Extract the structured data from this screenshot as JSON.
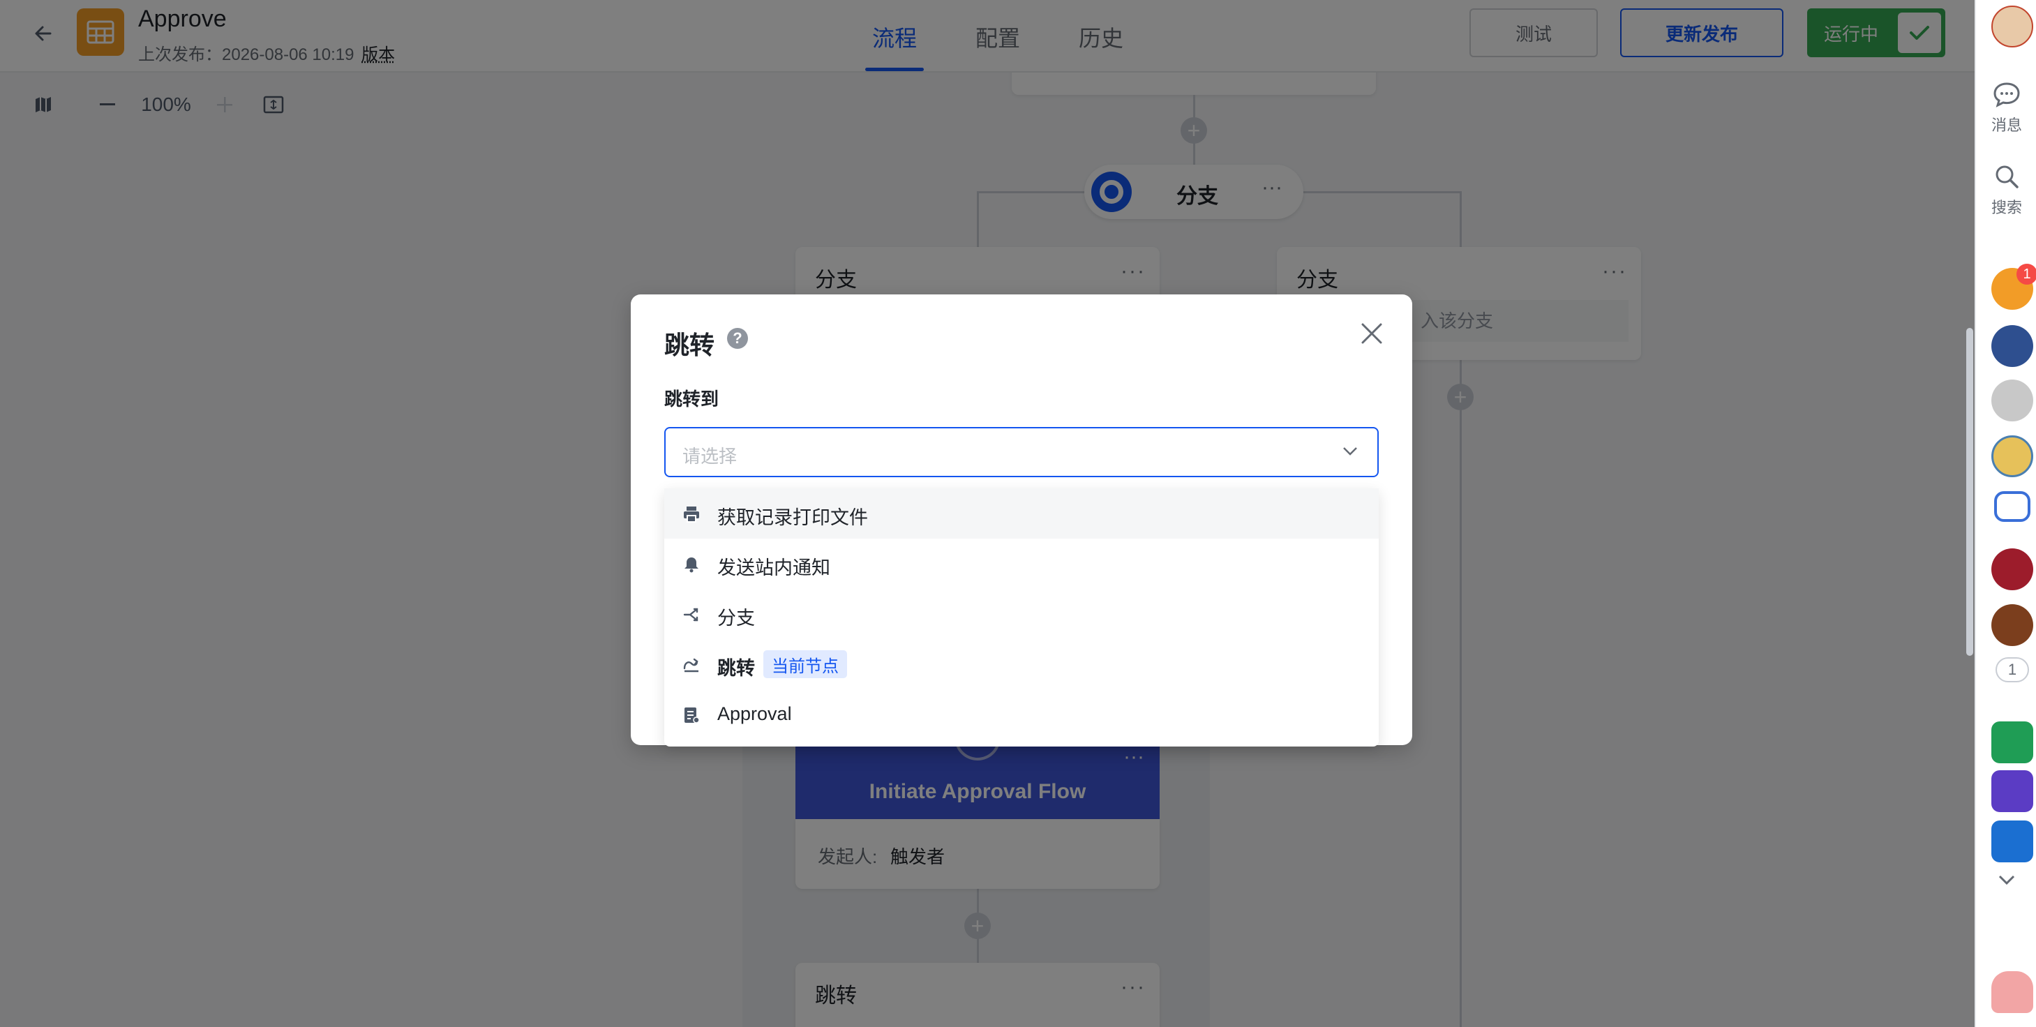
{
  "app": {
    "title": "Approve",
    "last_publish_label": "上次发布：2026-08-06 10:19",
    "version_link": "版本"
  },
  "tabs": [
    {
      "label": "流程",
      "active": true
    },
    {
      "label": "配置",
      "active": false
    },
    {
      "label": "历史",
      "active": false
    }
  ],
  "header_buttons": {
    "test": "测试",
    "publish": "更新发布",
    "running": "运行中"
  },
  "toolbar": {
    "zoom": "100%"
  },
  "canvas": {
    "branch_pill_label": "分支",
    "branch_left_title": "分支",
    "branch_right_title": "分支",
    "branch_right_hint": "入该分支",
    "banner_title": "Initiate Approval Flow",
    "initiator_label": "发起人:",
    "initiator_value": "触发者",
    "bottom_node_title": "跳转",
    "more_glyph": "···"
  },
  "rail": {
    "messages": "消息",
    "search": "搜索",
    "app_badge": "1",
    "counter": "1"
  },
  "modal": {
    "title": "跳转",
    "field_label": "跳转到",
    "placeholder": "请选择",
    "options": [
      {
        "icon": "printer-icon",
        "label": "获取记录打印文件"
      },
      {
        "icon": "bell-icon",
        "label": "发送站内通知"
      },
      {
        "icon": "branch-icon",
        "label": "分支"
      },
      {
        "icon": "jump-icon",
        "label": "跳转",
        "tag": "当前节点"
      },
      {
        "icon": "approval-doc-icon",
        "label": "Approval"
      }
    ]
  },
  "colors": {
    "accent": "#1456f0",
    "running": "#34a853",
    "app_logo": "#f29c27",
    "banner": "#3f57d8"
  }
}
